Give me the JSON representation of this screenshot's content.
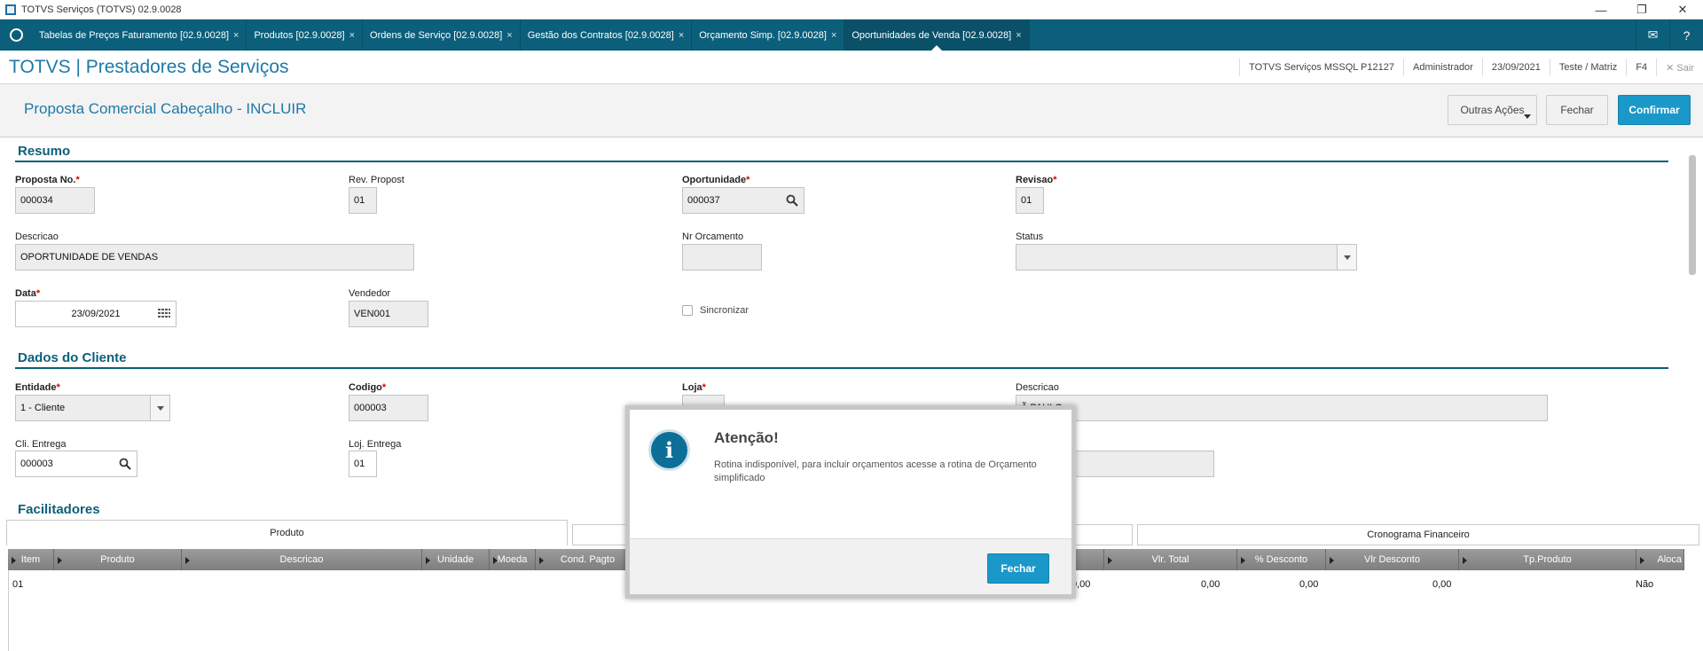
{
  "window": {
    "title": "TOTVS Serviços (TOTVS) 02.9.0028",
    "min": "—",
    "restore": "❐",
    "close": "✕"
  },
  "tabs": [
    {
      "label": "Tabelas de Preços Faturamento [02.9.0028]"
    },
    {
      "label": "Produtos [02.9.0028]"
    },
    {
      "label": "Ordens de Serviço [02.9.0028]"
    },
    {
      "label": "Gestão dos Contratos [02.9.0028]"
    },
    {
      "label": "Orçamento Simp. [02.9.0028]"
    },
    {
      "label": "Oportunidades de Venda [02.9.0028]"
    }
  ],
  "tab_close": "×",
  "header": {
    "brand": "TOTVS | Prestadores de Serviços",
    "env": "TOTVS Serviços MSSQL P12127",
    "user": "Administrador",
    "date": "23/09/2021",
    "branch": "Teste / Matriz",
    "f4": "F4",
    "exit": "✕  Sair"
  },
  "page": {
    "title": "Proposta Comercial Cabeçalho - INCLUIR",
    "other_actions": "Outras Ações",
    "close": "Fechar",
    "confirm": "Confirmar"
  },
  "resumo": {
    "title": "Resumo",
    "proposta_label": "Proposta No.",
    "proposta_value": "000034",
    "rev_label": "Rev. Propost",
    "rev_value": "01",
    "oport_label": "Oportunidade",
    "oport_value": "000037",
    "revisao_label": "Revisao",
    "revisao_value": "01",
    "descricao_label": "Descricao",
    "descricao_value": "OPORTUNIDADE DE VENDAS",
    "nrorc_label": "Nr Orcamento",
    "nrorc_value": "",
    "status_label": "Status",
    "status_value": "",
    "data_label": "Data",
    "data_value": "23/09/2021",
    "vendedor_label": "Vendedor",
    "vendedor_value": "VEN001",
    "sincronizar_label": "Sincronizar"
  },
  "cliente": {
    "title": "Dados do Cliente",
    "entidade_label": "Entidade",
    "entidade_value": "1 - Cliente",
    "codigo_label": "Codigo",
    "codigo_value": "000003",
    "loja_label": "Loja",
    "descricao_label": "Descricao",
    "descricao_value": "Ã PAULO",
    "cli_entrega_label": "Cli. Entrega",
    "cli_entrega_value": "000003",
    "loj_entrega_label": "Loj. Entrega",
    "loj_entrega_value": "01"
  },
  "facilitadores": {
    "title": "Facilitadores",
    "tab_produto": "Produto",
    "tab_cronograma": "Cronograma Financeiro"
  },
  "grid": {
    "columns": [
      "Item",
      "Produto",
      "Descricao",
      "Unidade",
      "Moeda",
      "Cond. Pagto",
      "Vlr. Total",
      "% Desconto",
      "Vlr Desconto",
      "Tp.Produto",
      "Aloca"
    ],
    "row": {
      "item": "01",
      "col_a": "0,00",
      "vlr_total": "0,00",
      "perc_desc": "0,00",
      "vlr_desc": "0,00",
      "tp_produto": "Não"
    }
  },
  "dialog": {
    "icon": "i",
    "title": "Atenção!",
    "message": "Rotina indisponível, para incluir orçamentos acesse a rotina de Orçamento simplificado",
    "button": "Fechar"
  }
}
